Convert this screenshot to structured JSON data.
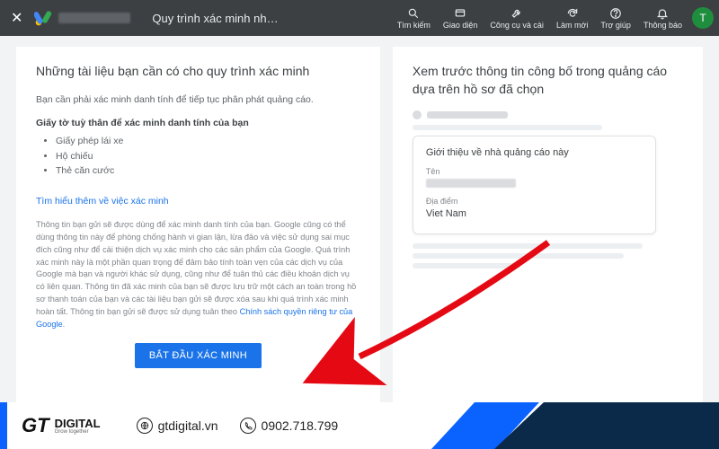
{
  "topbar": {
    "page_title": "Quy trình xác minh nhà q…",
    "tools": {
      "search": "Tìm kiếm",
      "appearance": "Giao diện",
      "tools_settings": "Công cụ và cài",
      "refresh": "Làm mới",
      "help": "Trợ giúp",
      "notifications": "Thông báo"
    },
    "avatar_initial": "T"
  },
  "left": {
    "heading": "Những tài liệu bạn cần có cho quy trình xác minh",
    "requirement": "Bạn cần phải xác minh danh tính để tiếp tục phân phát quảng cáo.",
    "docs_title": "Giấy tờ tuỳ thân để xác minh danh tính của bạn",
    "docs": [
      "Giấy phép lái xe",
      "Hộ chiếu",
      "Thẻ căn cước"
    ],
    "learn_more": "Tìm hiểu thêm về việc xác minh",
    "fine_print": "Thông tin bạn gửi sẽ được dùng để xác minh danh tính của bạn. Google cũng có thể dùng thông tin này để phòng chống hành vi gian lận, lừa đảo và việc sử dụng sai mục đích cũng như để cải thiện dịch vụ xác minh cho các sản phẩm của Google. Quá trình xác minh này là một phần quan trọng để đảm bảo tính toàn vẹn của các dịch vụ của Google mà bạn và người khác sử dụng, cũng như để tuân thủ các điều khoản dịch vụ có liên quan. Thông tin đã xác minh của bạn sẽ được lưu trữ một cách an toàn trong hồ sơ thanh toán của bạn và các tài liệu bạn gửi sẽ được xóa sau khi quá trình xác minh hoàn tất. Thông tin bạn gửi sẽ được sử dụng tuân theo ",
    "fine_print_link": "Chính sách quyền riêng tư của Google",
    "cta": "BẮT ĐẦU XÁC MINH"
  },
  "right": {
    "heading": "Xem trước thông tin công bố trong quảng cáo dựa trên hồ sơ đã chọn",
    "popup_title": "Giới thiệu về nhà quảng cáo này",
    "name_label": "Tên",
    "location_label": "Địa điểm",
    "location_value": "Viet Nam"
  },
  "brand": {
    "logo_big": "GT",
    "logo_small": "DIGITAL",
    "logo_tag": "Grow together",
    "website": "gtdigital.vn",
    "phone": "0902.718.799"
  }
}
